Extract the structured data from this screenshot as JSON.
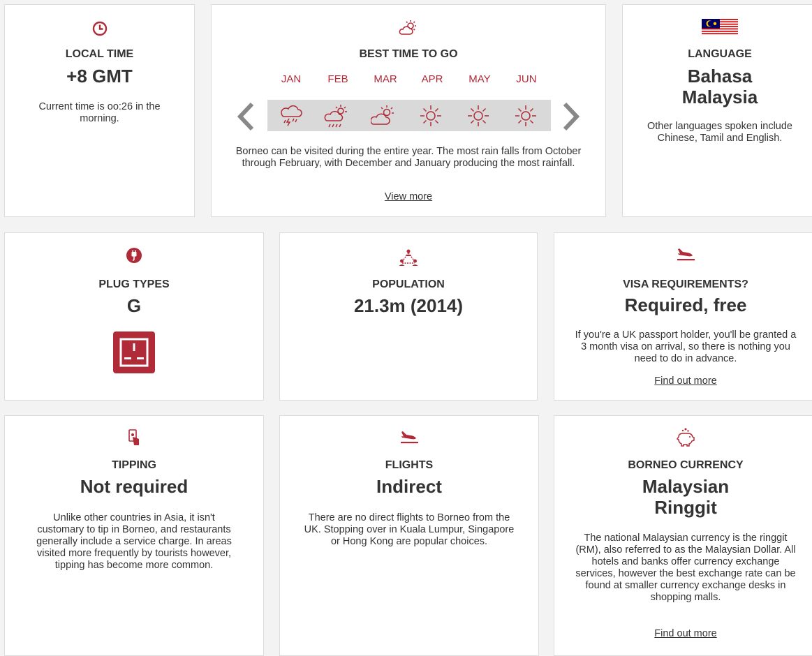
{
  "local_time": {
    "label": "LOCAL TIME",
    "value": "+8 GMT",
    "description": "Current time is oo:26 in the morning."
  },
  "best_time": {
    "label": "BEST TIME TO GO",
    "months": [
      "JAN",
      "FEB",
      "MAR",
      "APR",
      "MAY",
      "JUN"
    ],
    "weather": [
      "thunderstorm-icon",
      "sun-behind-rain-icon",
      "partly-cloudy-icon",
      "sunny-icon",
      "sunny-icon",
      "sunny-icon"
    ],
    "description": "Borneo can be visited during the entire year. The most rain falls from October through February, with December and January producing the most rainfall.",
    "link": "View more"
  },
  "language": {
    "label": "LANGUAGE",
    "value_line1": "Bahasa",
    "value_line2": "Malaysia",
    "description": "Other languages spoken include Chinese, Tamil and English."
  },
  "plug_types": {
    "label": "PLUG TYPES",
    "value": "G"
  },
  "population": {
    "label": "POPULATION",
    "value": "21.3m (2014)"
  },
  "visa": {
    "label": "VISA REQUIREMENTS?",
    "value": "Required, free",
    "description": "If you're a UK passport holder, you'll be granted a 3 month visa on arrival, so there is nothing you need to do in advance.",
    "link": "Find out more"
  },
  "tipping": {
    "label": "TIPPING",
    "value": "Not required",
    "description": "Unlike other countries in Asia, it isn't customary to tip in Borneo, and restaurants generally include a service charge. In areas visited more frequently by tourists however, tipping has become more common."
  },
  "flights": {
    "label": "FLIGHTS",
    "value": "Indirect",
    "description": "There are no direct flights to Borneo from the UK. Stopping over in Kuala Lumpur, Singapore or Hong Kong are popular choices."
  },
  "currency": {
    "label": "BORNEO CURRENCY",
    "value_line1": "Malaysian",
    "value_line2": "Ringgit",
    "description": "The national Malaysian currency is the ringgit (RM), also referred to as the Malaysian Dollar. All hotels and banks offer currency exchange services, however the best exchange rate can be found at smaller currency exchange desks in shopping malls.",
    "link": "Find out more"
  },
  "colors": {
    "accent": "#b12a37",
    "strip": "#d9d9d9",
    "arrow": "#888888",
    "background": "#f3f3f3"
  }
}
